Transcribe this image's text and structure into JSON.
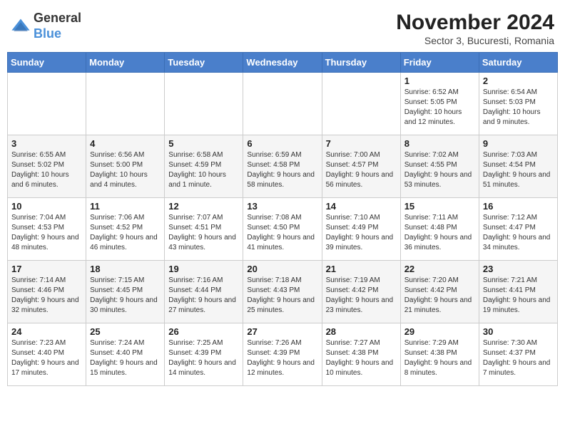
{
  "logo": {
    "general": "General",
    "blue": "Blue"
  },
  "title": "November 2024",
  "subtitle": "Sector 3, Bucuresti, Romania",
  "days_of_week": [
    "Sunday",
    "Monday",
    "Tuesday",
    "Wednesday",
    "Thursday",
    "Friday",
    "Saturday"
  ],
  "weeks": [
    [
      {
        "day": "",
        "info": ""
      },
      {
        "day": "",
        "info": ""
      },
      {
        "day": "",
        "info": ""
      },
      {
        "day": "",
        "info": ""
      },
      {
        "day": "",
        "info": ""
      },
      {
        "day": "1",
        "info": "Sunrise: 6:52 AM\nSunset: 5:05 PM\nDaylight: 10 hours and 12 minutes."
      },
      {
        "day": "2",
        "info": "Sunrise: 6:54 AM\nSunset: 5:03 PM\nDaylight: 10 hours and 9 minutes."
      }
    ],
    [
      {
        "day": "3",
        "info": "Sunrise: 6:55 AM\nSunset: 5:02 PM\nDaylight: 10 hours and 6 minutes."
      },
      {
        "day": "4",
        "info": "Sunrise: 6:56 AM\nSunset: 5:00 PM\nDaylight: 10 hours and 4 minutes."
      },
      {
        "day": "5",
        "info": "Sunrise: 6:58 AM\nSunset: 4:59 PM\nDaylight: 10 hours and 1 minute."
      },
      {
        "day": "6",
        "info": "Sunrise: 6:59 AM\nSunset: 4:58 PM\nDaylight: 9 hours and 58 minutes."
      },
      {
        "day": "7",
        "info": "Sunrise: 7:00 AM\nSunset: 4:57 PM\nDaylight: 9 hours and 56 minutes."
      },
      {
        "day": "8",
        "info": "Sunrise: 7:02 AM\nSunset: 4:55 PM\nDaylight: 9 hours and 53 minutes."
      },
      {
        "day": "9",
        "info": "Sunrise: 7:03 AM\nSunset: 4:54 PM\nDaylight: 9 hours and 51 minutes."
      }
    ],
    [
      {
        "day": "10",
        "info": "Sunrise: 7:04 AM\nSunset: 4:53 PM\nDaylight: 9 hours and 48 minutes."
      },
      {
        "day": "11",
        "info": "Sunrise: 7:06 AM\nSunset: 4:52 PM\nDaylight: 9 hours and 46 minutes."
      },
      {
        "day": "12",
        "info": "Sunrise: 7:07 AM\nSunset: 4:51 PM\nDaylight: 9 hours and 43 minutes."
      },
      {
        "day": "13",
        "info": "Sunrise: 7:08 AM\nSunset: 4:50 PM\nDaylight: 9 hours and 41 minutes."
      },
      {
        "day": "14",
        "info": "Sunrise: 7:10 AM\nSunset: 4:49 PM\nDaylight: 9 hours and 39 minutes."
      },
      {
        "day": "15",
        "info": "Sunrise: 7:11 AM\nSunset: 4:48 PM\nDaylight: 9 hours and 36 minutes."
      },
      {
        "day": "16",
        "info": "Sunrise: 7:12 AM\nSunset: 4:47 PM\nDaylight: 9 hours and 34 minutes."
      }
    ],
    [
      {
        "day": "17",
        "info": "Sunrise: 7:14 AM\nSunset: 4:46 PM\nDaylight: 9 hours and 32 minutes."
      },
      {
        "day": "18",
        "info": "Sunrise: 7:15 AM\nSunset: 4:45 PM\nDaylight: 9 hours and 30 minutes."
      },
      {
        "day": "19",
        "info": "Sunrise: 7:16 AM\nSunset: 4:44 PM\nDaylight: 9 hours and 27 minutes."
      },
      {
        "day": "20",
        "info": "Sunrise: 7:18 AM\nSunset: 4:43 PM\nDaylight: 9 hours and 25 minutes."
      },
      {
        "day": "21",
        "info": "Sunrise: 7:19 AM\nSunset: 4:42 PM\nDaylight: 9 hours and 23 minutes."
      },
      {
        "day": "22",
        "info": "Sunrise: 7:20 AM\nSunset: 4:42 PM\nDaylight: 9 hours and 21 minutes."
      },
      {
        "day": "23",
        "info": "Sunrise: 7:21 AM\nSunset: 4:41 PM\nDaylight: 9 hours and 19 minutes."
      }
    ],
    [
      {
        "day": "24",
        "info": "Sunrise: 7:23 AM\nSunset: 4:40 PM\nDaylight: 9 hours and 17 minutes."
      },
      {
        "day": "25",
        "info": "Sunrise: 7:24 AM\nSunset: 4:40 PM\nDaylight: 9 hours and 15 minutes."
      },
      {
        "day": "26",
        "info": "Sunrise: 7:25 AM\nSunset: 4:39 PM\nDaylight: 9 hours and 14 minutes."
      },
      {
        "day": "27",
        "info": "Sunrise: 7:26 AM\nSunset: 4:39 PM\nDaylight: 9 hours and 12 minutes."
      },
      {
        "day": "28",
        "info": "Sunrise: 7:27 AM\nSunset: 4:38 PM\nDaylight: 9 hours and 10 minutes."
      },
      {
        "day": "29",
        "info": "Sunrise: 7:29 AM\nSunset: 4:38 PM\nDaylight: 9 hours and 8 minutes."
      },
      {
        "day": "30",
        "info": "Sunrise: 7:30 AM\nSunset: 4:37 PM\nDaylight: 9 hours and 7 minutes."
      }
    ]
  ]
}
